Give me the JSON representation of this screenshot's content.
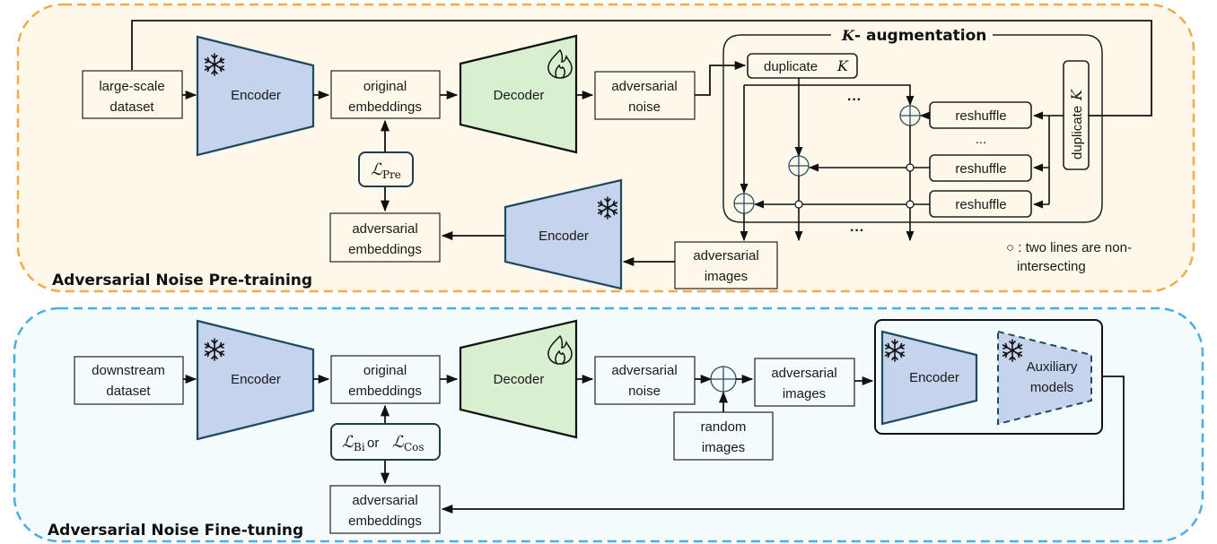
{
  "colors": {
    "pretrain_bg": "#fdf8ea",
    "pretrain_border": "#f0ac45",
    "finetune_bg": "#f3fbfd",
    "finetune_border": "#4aaee0",
    "encoder_fill": "#c5d3ec",
    "encoder_stroke": "#1d4a62",
    "decoder_fill": "#d8efd0"
  },
  "pretrain": {
    "title": "Adversarial Noise Pre-training",
    "dataset": [
      "large-scale",
      "dataset"
    ],
    "encoder": "Encoder",
    "encoder2": "Encoder",
    "decoder": "Decoder",
    "original_embeddings": [
      "original",
      "embeddings"
    ],
    "adversarial_embeddings": [
      "adversarial",
      "embeddings"
    ],
    "adversarial_noise": [
      "adversarial",
      "noise"
    ],
    "adversarial_images": [
      "adversarial",
      "images"
    ],
    "loss": {
      "symbol": "ℒ",
      "sub": "Pre"
    },
    "icons": {
      "frozen": "snowflake-icon",
      "trainable": "flame-icon"
    },
    "k_aug": {
      "title_var": "K",
      "title_rest": " - augmentation",
      "duplicate_top": "duplicate ",
      "duplicate_var": "K",
      "duplicate_side": "duplicate ",
      "reshuffle": [
        "reshuffle",
        "reshuffle",
        "reshuffle"
      ],
      "ellipsis": "···",
      "ellipsis_small": "...",
      "legend": [
        "○ : two lines are non-",
        "intersecting"
      ]
    }
  },
  "finetune": {
    "title": "Adversarial Noise Fine-tuning",
    "dataset": [
      "downstream",
      "dataset"
    ],
    "encoder": "Encoder",
    "decoder": "Decoder",
    "original_embeddings": [
      "original",
      "embeddings"
    ],
    "adversarial_embeddings": [
      "adversarial",
      "embeddings"
    ],
    "adversarial_noise": [
      "adversarial",
      "noise"
    ],
    "adversarial_images": [
      "adversarial",
      "images"
    ],
    "random_images": [
      "random",
      "images"
    ],
    "loss": {
      "symbol": "ℒ",
      "sub1": "Bi",
      "or": " or ",
      "sub2": "Cos"
    },
    "target_encoder": "Encoder",
    "auxiliary": [
      "Auxiliary",
      "models"
    ]
  }
}
